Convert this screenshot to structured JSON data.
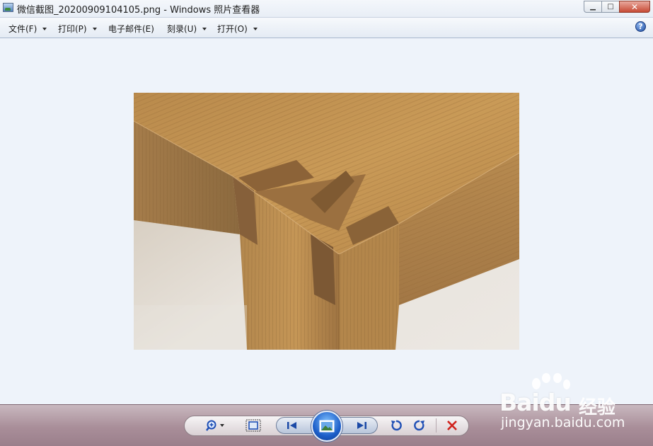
{
  "window": {
    "title": "微信截图_20200909104105.png - Windows 照片查看器",
    "controls": {
      "minimize": "▁",
      "maximize": "□",
      "close": "✕"
    }
  },
  "menubar": {
    "items": [
      {
        "label": "文件(F)",
        "has_dropdown": true
      },
      {
        "label": "打印(P)",
        "has_dropdown": true
      },
      {
        "label": "电子邮件(E)",
        "has_dropdown": false
      },
      {
        "label": "刻录(U)",
        "has_dropdown": true
      },
      {
        "label": "打开(O)",
        "has_dropdown": true
      }
    ],
    "help_label": "?"
  },
  "viewer": {
    "background_color": "#eef3fa",
    "image_subject": "oak-wood-table-corner-joint"
  },
  "controls": {
    "zoom_icon": "zoom-icon",
    "fit_icon": "actual-size-icon",
    "prev_icon": "previous-icon",
    "slideshow_icon": "slideshow-icon",
    "next_icon": "next-icon",
    "rotate_left_icon": "rotate-counterclockwise-icon",
    "rotate_right_icon": "rotate-clockwise-icon",
    "delete_icon": "delete-icon",
    "accent_color": "#1d5fc9",
    "delete_color": "#d0231d"
  },
  "watermark": {
    "brand": "Baidu",
    "brand_cn": "经验",
    "url": "jingyan.baidu.com"
  }
}
